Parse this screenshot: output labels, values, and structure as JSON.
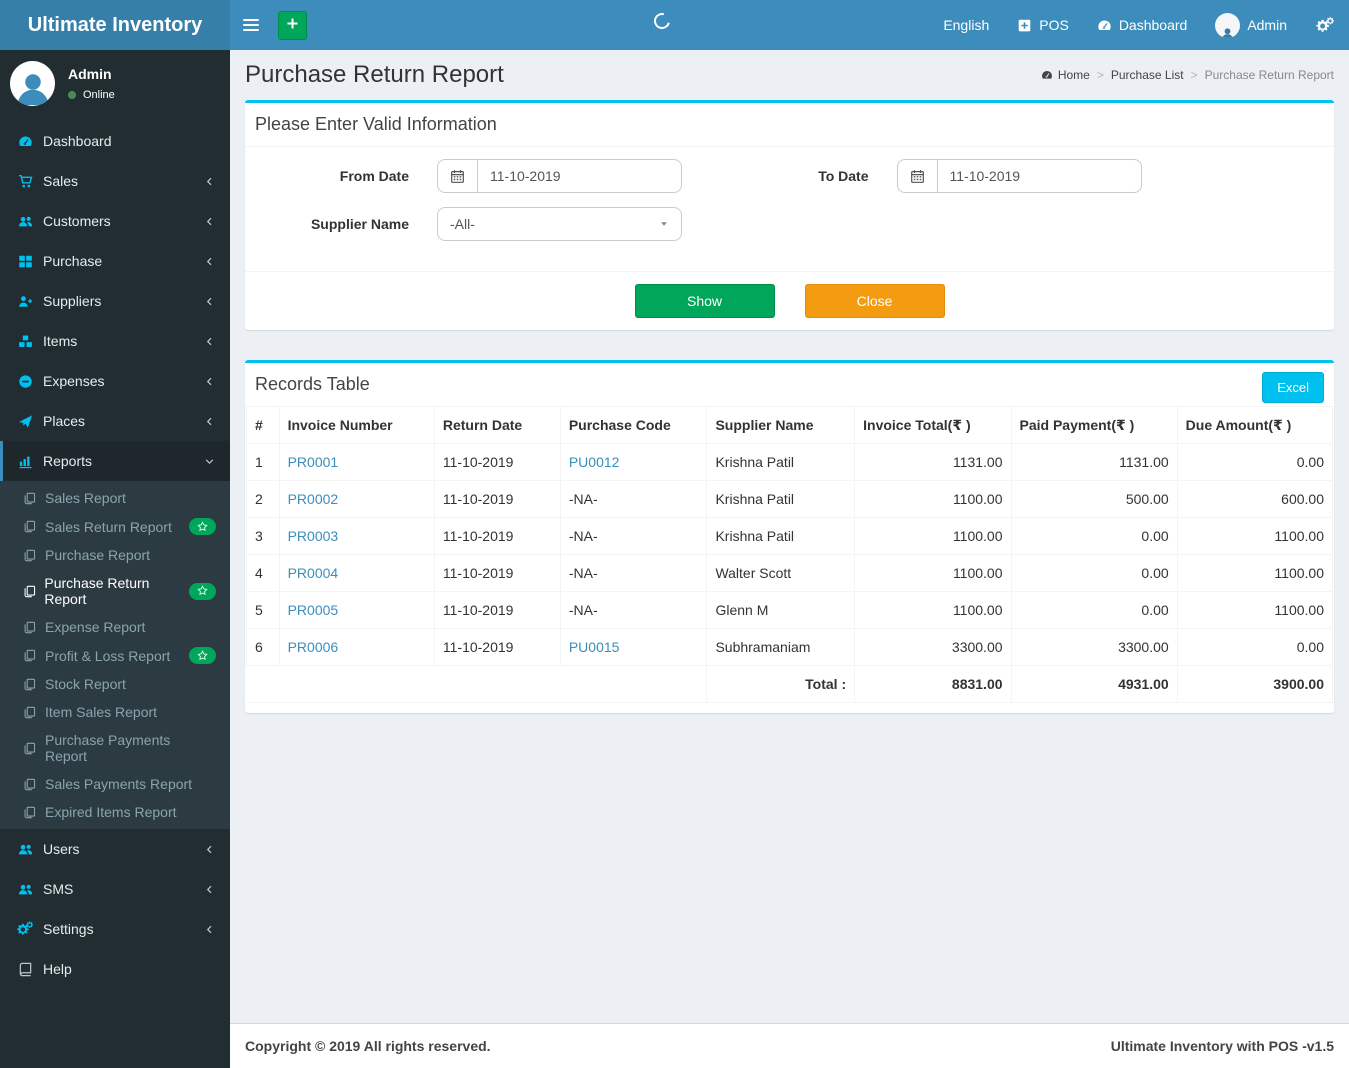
{
  "app": {
    "name": "Ultimate Inventory"
  },
  "navbar": {
    "language_label": "English",
    "pos_label": "POS",
    "dashboard_label": "Dashboard",
    "user_name": "Admin"
  },
  "user_panel": {
    "name": "Admin",
    "status": "Online"
  },
  "sidebar": {
    "menu": [
      {
        "label": "Dashboard",
        "icon": "tachometer"
      },
      {
        "label": "Sales",
        "icon": "cart",
        "chevron": true
      },
      {
        "label": "Customers",
        "icon": "users",
        "chevron": true
      },
      {
        "label": "Purchase",
        "icon": "grid",
        "chevron": true
      },
      {
        "label": "Suppliers",
        "icon": "user-plus",
        "chevron": true
      },
      {
        "label": "Items",
        "icon": "cubes",
        "chevron": true
      },
      {
        "label": "Expenses",
        "icon": "minus-circle",
        "chevron": true
      },
      {
        "label": "Places",
        "icon": "paper-plane",
        "chevron": true
      },
      {
        "label": "Reports",
        "icon": "bar-chart",
        "active": true,
        "expanded": true,
        "children": [
          {
            "label": "Sales Report"
          },
          {
            "label": "Sales Return Report",
            "badge": "star"
          },
          {
            "label": "Purchase Report"
          },
          {
            "label": "Purchase Return Report",
            "badge": "star",
            "active": true
          },
          {
            "label": "Expense Report"
          },
          {
            "label": "Profit & Loss Report",
            "badge": "star"
          },
          {
            "label": "Stock Report"
          },
          {
            "label": "Item Sales Report"
          },
          {
            "label": "Purchase Payments Report"
          },
          {
            "label": "Sales Payments Report"
          },
          {
            "label": "Expired Items Report"
          }
        ]
      },
      {
        "label": "Users",
        "icon": "users",
        "chevron": true
      },
      {
        "label": "SMS",
        "icon": "users",
        "chevron": true
      },
      {
        "label": "Settings",
        "icon": "cogs",
        "chevron": true
      },
      {
        "label": "Help",
        "icon": "book",
        "icon_color": "#b8c7ce"
      }
    ]
  },
  "page": {
    "title": "Purchase Return Report",
    "separator": ">",
    "breadcrumb": [
      {
        "label": "Home",
        "icon": "tachometer"
      },
      {
        "label": "Purchase List"
      },
      {
        "label": "Purchase Return Report",
        "current": true
      }
    ]
  },
  "filter": {
    "title": "Please Enter Valid Information",
    "from_date": {
      "label": "From Date",
      "value": "11-10-2019"
    },
    "to_date": {
      "label": "To Date",
      "value": "11-10-2019"
    },
    "supplier": {
      "label": "Supplier Name",
      "value": "-All-"
    },
    "show_label": "Show",
    "close_label": "Close"
  },
  "records": {
    "title": "Records Table",
    "excel_label": "Excel",
    "columns": [
      "#",
      "Invoice Number",
      "Return Date",
      "Purchase Code",
      "Supplier Name",
      "Invoice Total(₹ )",
      "Paid Payment(₹ )",
      "Due Amount(₹ )"
    ],
    "rows": [
      {
        "sl": "1",
        "invoice": "PR0001",
        "return_date": "11-10-2019",
        "purchase_code": "PU0012",
        "code_link": true,
        "supplier": "Krishna Patil",
        "invoice_total": "1131.00",
        "paid_payment": "1131.00",
        "due_amount": "0.00"
      },
      {
        "sl": "2",
        "invoice": "PR0002",
        "return_date": "11-10-2019",
        "purchase_code": "-NA-",
        "code_link": false,
        "supplier": "Krishna Patil",
        "invoice_total": "1100.00",
        "paid_payment": "500.00",
        "due_amount": "600.00"
      },
      {
        "sl": "3",
        "invoice": "PR0003",
        "return_date": "11-10-2019",
        "purchase_code": "-NA-",
        "code_link": false,
        "supplier": "Krishna Patil",
        "invoice_total": "1100.00",
        "paid_payment": "0.00",
        "due_amount": "1100.00"
      },
      {
        "sl": "4",
        "invoice": "PR0004",
        "return_date": "11-10-2019",
        "purchase_code": "-NA-",
        "code_link": false,
        "supplier": "Walter Scott",
        "invoice_total": "1100.00",
        "paid_payment": "0.00",
        "due_amount": "1100.00"
      },
      {
        "sl": "5",
        "invoice": "PR0005",
        "return_date": "11-10-2019",
        "purchase_code": "-NA-",
        "code_link": false,
        "supplier": "Glenn M",
        "invoice_total": "1100.00",
        "paid_payment": "0.00",
        "due_amount": "1100.00"
      },
      {
        "sl": "6",
        "invoice": "PR0006",
        "return_date": "11-10-2019",
        "purchase_code": "PU0015",
        "code_link": true,
        "supplier": "Subhramaniam",
        "invoice_total": "3300.00",
        "paid_payment": "3300.00",
        "due_amount": "0.00"
      }
    ],
    "total": {
      "label": "Total :",
      "invoice_total": "8831.00",
      "paid_payment": "4931.00",
      "due_amount": "3900.00"
    }
  },
  "footer": {
    "left": "Copyright © 2019 All rights reserved.",
    "right": "Ultimate Inventory with POS -v1.5"
  },
  "colors": {
    "navbar": "#3c8dbc",
    "logo_bg": "#367fa9",
    "sidebar_bg": "#222d32",
    "submenu_bg": "#2c3b41",
    "accent_cyan": "#00c0ef",
    "success_green": "#00a65a",
    "warning_orange": "#f39c12",
    "link_blue": "#3c8dbc"
  }
}
